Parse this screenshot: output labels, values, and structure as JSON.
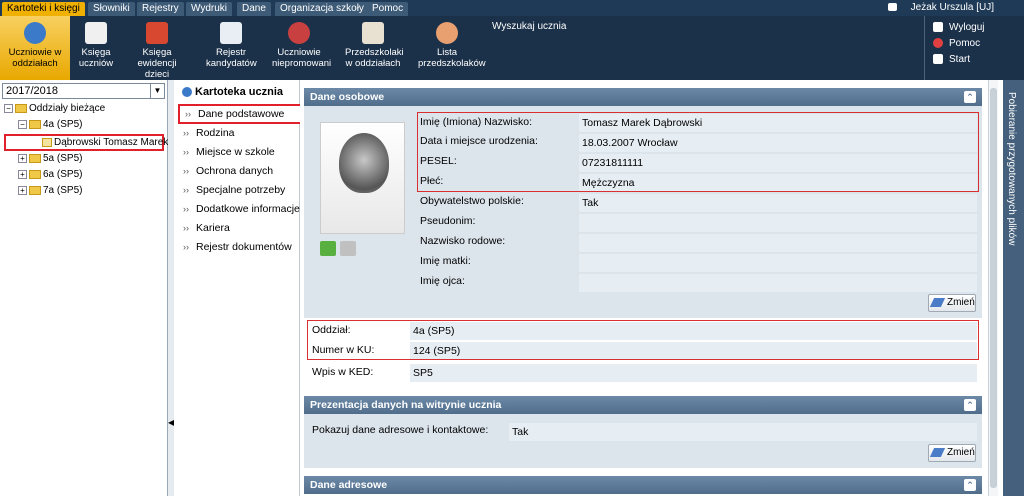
{
  "menu_tabs": [
    "Kartoteki i księgi",
    "Słowniki",
    "Rejestry",
    "Wydruki",
    "Dane",
    "Organizacja szkoły",
    "Pomoc"
  ],
  "user": "Jeżak Urszula [UJ]",
  "ribbon": {
    "buttons": [
      "Uczniowie w oddziałach",
      "Księga uczniów",
      "Księga ewidencji dzieci",
      "Rejestr kandydatów",
      "Uczniowie niepromowani",
      "Przedszkolaki w oddziałach",
      "Lista przedszkolaków"
    ],
    "search_label": "Wyszukaj ucznia",
    "side": [
      "Wyloguj",
      "Pomoc",
      "Start"
    ]
  },
  "left": {
    "year": "2017/2018",
    "tree": {
      "root": "Oddziały bieżące",
      "class_4a": "4a (SP5)",
      "student": "Dąbrowski Tomasz Marek",
      "class_5a": "5a (SP5)",
      "class_6a": "6a (SP5)",
      "class_7a": "7a (SP5)"
    }
  },
  "kartoteka": {
    "title": "Kartoteka ucznia",
    "items": [
      "Dane podstawowe",
      "Rodzina",
      "Miejsce w szkole",
      "Ochrona danych",
      "Specjalne potrzeby",
      "Dodatkowe informacje",
      "Kariera",
      "Rejestr dokumentów"
    ]
  },
  "dane_osobowe": {
    "header": "Dane osobowe",
    "imie_label": "Imię (Imiona) Nazwisko:",
    "imie_value": "Tomasz Marek Dąbrowski",
    "data_label": "Data i miejsce urodzenia:",
    "data_value": "18.03.2007 Wrocław",
    "pesel_label": "PESEL:",
    "pesel_value": "07231811111",
    "plec_label": "Płeć:",
    "plec_value": "Mężczyzna",
    "obyw_label": "Obywatelstwo polskie:",
    "obyw_value": "Tak",
    "pseudonim_label": "Pseudonim:",
    "rodowe_label": "Nazwisko rodowe:",
    "matki_label": "Imię matki:",
    "ojca_label": "Imię ojca:",
    "zmien": "Zmień",
    "oddzial_label": "Oddział:",
    "oddzial_value": "4a (SP5)",
    "ku_label": "Numer w KU:",
    "ku_value": "124 (SP5)",
    "ked_label": "Wpis w KED:",
    "ked_value": "SP5"
  },
  "prezentacja": {
    "header": "Prezentacja danych na witrynie ucznia",
    "label": "Pokazuj dane adresowe i kontaktowe:",
    "value": "Tak",
    "zmien": "Zmień"
  },
  "adresowe": {
    "header": "Dane adresowe"
  },
  "sidebar_label": "Pobieranie przygotowanych plików"
}
